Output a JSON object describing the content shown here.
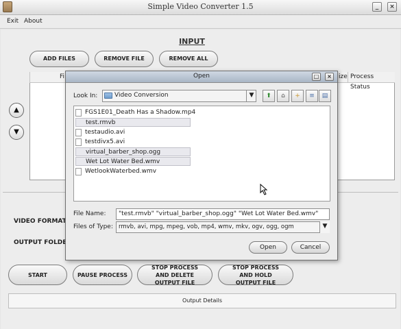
{
  "window": {
    "title": "Simple Video Converter 1.5"
  },
  "menu": [
    {
      "label": "Exit"
    },
    {
      "label": "About"
    }
  ],
  "input": {
    "heading": "INPUT",
    "buttons": {
      "add": "ADD FILES",
      "remove": "REMOVE FILE",
      "remove_all": "REMOVE ALL"
    },
    "table_columns": {
      "c1": "Fi",
      "c2": "ize",
      "c3": "Process Status"
    }
  },
  "settings": {
    "video_format_label": "VIDEO FORMAT",
    "output_folder_label": "OUTPUT FOLDE"
  },
  "controls": {
    "start": "START",
    "pause": "PAUSE PROCESS",
    "stop_delete": "STOP PROCESS AND DELETE OUTPUT FILE",
    "stop_hold": "STOP PROCESS AND HOLD OUTPUT FILE"
  },
  "output_details": "Output Details",
  "dialog": {
    "title": "Open",
    "look_in_label": "Look In:",
    "look_in_value": "Video Conversion",
    "files": [
      {
        "name": "FGS1E01_Death Has a Shadow.mp4",
        "selected": false
      },
      {
        "name": "test.rmvb",
        "selected": true
      },
      {
        "name": "testaudio.avi",
        "selected": false
      },
      {
        "name": "testdivx5.avi",
        "selected": false
      },
      {
        "name": "virtual_barber_shop.ogg",
        "selected": true
      },
      {
        "name": "Wet Lot Water Bed.wmv",
        "selected": true
      },
      {
        "name": "WetlookWaterbed.wmv",
        "selected": false
      }
    ],
    "file_name_label": "File Name:",
    "file_name_value": "\"test.rmvb\" \"virtual_barber_shop.ogg\" \"Wet Lot Water Bed.wmv\"",
    "files_of_type_label": "Files of Type:",
    "files_of_type_value": "rmvb, avi, mpg, mpeg, vob, mp4, wmv, mkv, ogv, ogg, ogm",
    "open_label": "Open",
    "cancel_label": "Cancel"
  }
}
